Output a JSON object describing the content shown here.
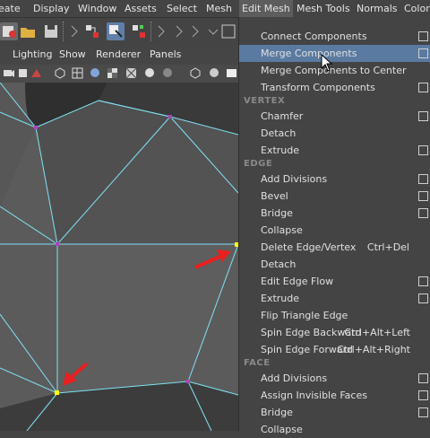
{
  "menubar": {
    "items": [
      "eate",
      "Display",
      "Window",
      "Assets",
      "Select",
      "Mesh",
      "Edit Mesh",
      "Mesh Tools",
      "Normals",
      "Color"
    ],
    "active": "Edit Mesh"
  },
  "panel_menu": {
    "items": [
      "Lighting",
      "Show",
      "Renderer",
      "Panels"
    ]
  },
  "edit_mesh_menu": {
    "top_items": [
      {
        "label": "Connect Components",
        "option_box": true
      },
      {
        "label": "Merge Components",
        "option_box": true,
        "highlighted": true
      },
      {
        "label": "Merge Components to Center",
        "option_box": false
      },
      {
        "label": "Transform Components",
        "option_box": true
      }
    ],
    "sections": [
      {
        "title": "VERTEX",
        "items": [
          {
            "label": "Chamfer",
            "option_box": true
          },
          {
            "label": "Detach",
            "option_box": false
          },
          {
            "label": "Extrude",
            "option_box": true
          }
        ]
      },
      {
        "title": "EDGE",
        "items": [
          {
            "label": "Add Divisions",
            "option_box": true
          },
          {
            "label": "Bevel",
            "option_box": true
          },
          {
            "label": "Bridge",
            "option_box": true
          },
          {
            "label": "Collapse",
            "option_box": false
          },
          {
            "label": "Delete Edge/Vertex",
            "shortcut": "Ctrl+Del",
            "option_box": false
          },
          {
            "label": "Detach",
            "option_box": false
          },
          {
            "label": "Edit Edge Flow",
            "option_box": true
          },
          {
            "label": "Extrude",
            "option_box": true
          },
          {
            "label": "Flip Triangle Edge",
            "option_box": false
          },
          {
            "label": "Spin Edge Backward",
            "shortcut": "Ctrl+Alt+Left",
            "option_box": false
          },
          {
            "label": "Spin Edge Forward",
            "shortcut": "Ctrl+Alt+Right",
            "option_box": false
          }
        ]
      },
      {
        "title": "FACE",
        "items": [
          {
            "label": "Add Divisions",
            "option_box": true
          },
          {
            "label": "Assign Invisible Faces",
            "option_box": true
          },
          {
            "label": "Bridge",
            "option_box": true
          },
          {
            "label": "Collapse",
            "option_box": false
          }
        ]
      }
    ]
  },
  "colors": {
    "menu_bg": "#444444",
    "highlight": "#5a7aa1",
    "wire": "#7fe3f5",
    "vertex_selected": "#ffff00",
    "vertex": "#b040c0",
    "arrow": "#e82020"
  },
  "icons": [
    "open-folder-icon",
    "save-icon",
    "undo-icon",
    "redo-icon",
    "select-tool-icon",
    "lasso-icon",
    "paint-select-icon",
    "magnet-icon",
    "camera-icon",
    "grid-icon",
    "wireframe-icon",
    "smooth-shade-icon",
    "texture-icon",
    "light-icon",
    "isolate-icon",
    "xray-icon"
  ]
}
